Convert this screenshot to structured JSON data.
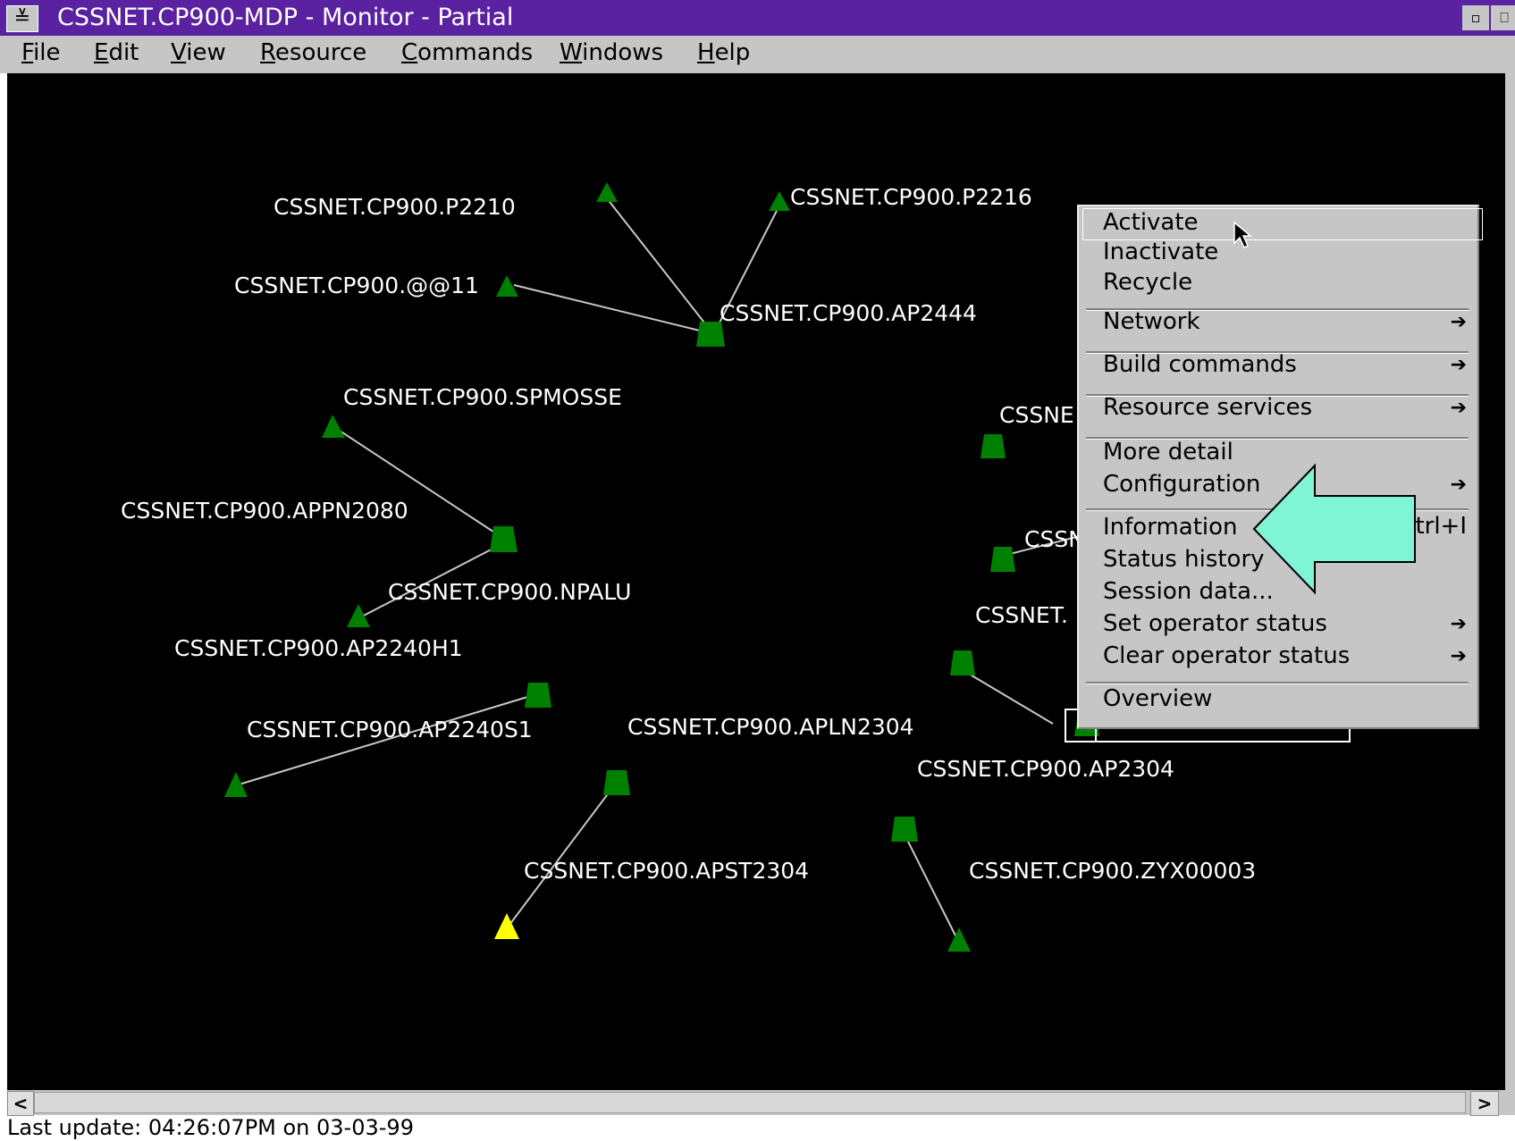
{
  "window": {
    "title": "CSSNET.CP900-MDP - Monitor - Partial",
    "sysmenu_glyph": "≚",
    "min_glyph": "▫",
    "max_glyph": "⎕"
  },
  "menubar": [
    {
      "label": "File",
      "mnemonic": "F",
      "rest": "ile"
    },
    {
      "label": "Edit",
      "mnemonic": "E",
      "rest": "dit"
    },
    {
      "label": "View",
      "mnemonic": "V",
      "rest": "iew"
    },
    {
      "label": "Resource",
      "mnemonic": "R",
      "rest": "esource"
    },
    {
      "label": "Commands",
      "mnemonic": "C",
      "rest": "ommands"
    },
    {
      "label": "Windows",
      "mnemonic": "W",
      "rest": "indows"
    },
    {
      "label": "Help",
      "mnemonic": "H",
      "rest": "elp"
    }
  ],
  "nodes": {
    "p2210": "CSSNET.CP900.P2210",
    "p2216": "CSSNET.CP900.P2216",
    "at11": "CSSNET.CP900.@@11",
    "ap2444": "CSSNET.CP900.AP2444",
    "spmosse": "CSSNET.CP900.SPMOSSE",
    "appn2080": "CSSNET.CP900.APPN2080",
    "npalu": "CSSNET.CP900.NPALU",
    "ap2240h1": "CSSNET.CP900.AP2240H1",
    "ap2240s1": "CSSNET.CP900.AP2240S1",
    "apln2304": "CSSNET.CP900.APLN2304",
    "ap2304": "CSSNET.CP900.AP2304",
    "apst2304": "CSSNET.CP900.APST2304",
    "zyx00003": "CSSNET.CP900.ZYX00003",
    "partial1": "CSSNE",
    "partial2": "CSSN",
    "partial3": "CSSNET."
  },
  "colors": {
    "node_ok": "#008000",
    "node_warn": "#ffff00",
    "canvas_bg": "#000000",
    "arrow_fill": "#7ff5d6"
  },
  "context_menu": {
    "activate": "Activate",
    "inactivate": "Inactivate",
    "recycle": "Recycle",
    "network": "Network",
    "build_commands": "Build commands",
    "resource_services": "Resource services",
    "more_detail": "More detail",
    "configuration": "Configuration",
    "information": "Information",
    "information_shortcut": "trl+I",
    "status_history": "Status history",
    "session_data": "Session data...",
    "set_operator_status": "Set operator status",
    "clear_operator_status": "Clear operator status",
    "overview": "Overview",
    "submenu_arrow": "➔"
  },
  "status": {
    "last_update": "Last update: 04:26:07PM on 03-03-99"
  },
  "scrollbar": {
    "left_arrow": "<",
    "right_arrow": ">"
  }
}
